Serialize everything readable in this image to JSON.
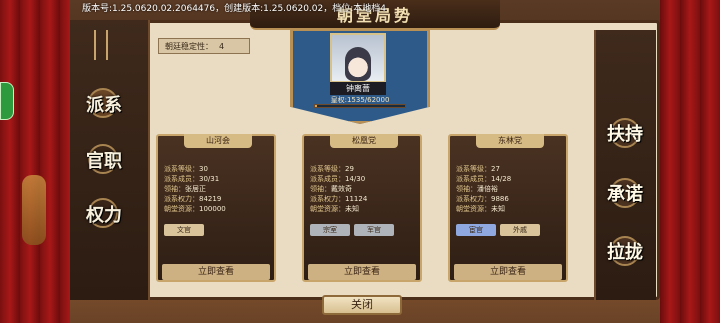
{
  "version_text": "版本号:1.25.0620.02.2064476，创建版本:1.25.0620.02，档位:本地档4",
  "title": "朝堂局势",
  "stability": {
    "label": "朝廷稳定性：",
    "value": "4"
  },
  "leader": {
    "name": "钟离蔷",
    "influence": "皇权:1535/62000",
    "influence_fraction": 0.025
  },
  "left_tabs": [
    {
      "label": "派系"
    },
    {
      "label": "官职"
    },
    {
      "label": "权力"
    }
  ],
  "right_buttons": [
    {
      "label": "扶持"
    },
    {
      "label": "承诺"
    },
    {
      "label": "拉拢"
    }
  ],
  "factions": [
    {
      "name": "山河会",
      "lines": [
        {
          "k": "派系等级：",
          "v": "30"
        },
        {
          "k": "派系成员：",
          "v": "30/31"
        },
        {
          "k": "领袖：",
          "v": "张居正"
        },
        {
          "k": "派系权力：",
          "v": "84219"
        },
        {
          "k": "朝堂资源：",
          "v": "100000"
        }
      ],
      "tags": [
        {
          "label": "文官",
          "style": "wen"
        }
      ],
      "view_label": "立即查看"
    },
    {
      "name": "松凰党",
      "lines": [
        {
          "k": "派系等级：",
          "v": "29"
        },
        {
          "k": "派系成员：",
          "v": "14/30"
        },
        {
          "k": "领袖：",
          "v": "戴效奇"
        },
        {
          "k": "派系权力：",
          "v": "11124"
        },
        {
          "k": "朝堂资源：",
          "v": "未知"
        }
      ],
      "tags": [
        {
          "label": "宗室",
          "style": "grey"
        },
        {
          "label": "军官",
          "style": "grey"
        }
      ],
      "view_label": "立即查看"
    },
    {
      "name": "东林党",
      "lines": [
        {
          "k": "派系等级：",
          "v": "27"
        },
        {
          "k": "派系成员：",
          "v": "14/28"
        },
        {
          "k": "领袖：",
          "v": "潘倍裕"
        },
        {
          "k": "派系权力：",
          "v": "9886"
        },
        {
          "k": "朝堂资源：",
          "v": "未知"
        }
      ],
      "tags": [
        {
          "label": "宦官",
          "style": "blue"
        },
        {
          "label": "外戚",
          "style": "cream"
        }
      ],
      "view_label": "立即查看"
    }
  ],
  "close_label": "关闭"
}
